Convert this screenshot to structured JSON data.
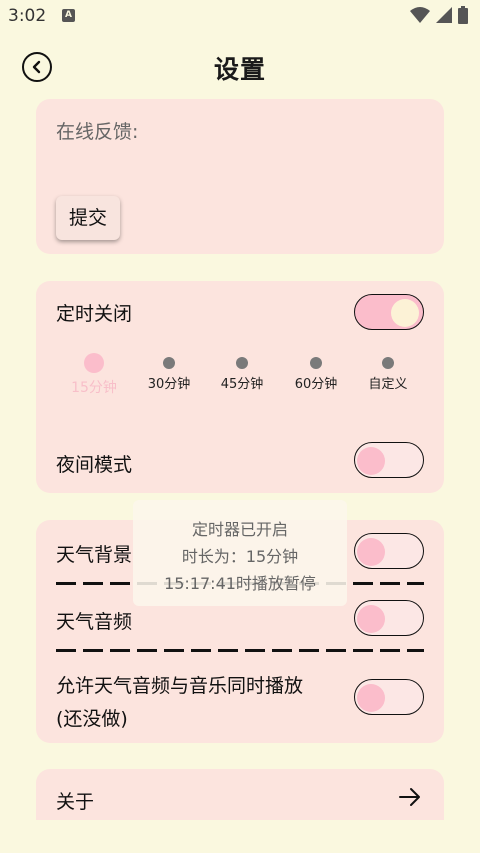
{
  "status_bar": {
    "time": "3:02",
    "notif_letter": "A"
  },
  "header": {
    "title": "设置"
  },
  "feedback": {
    "label": "在线反馈:",
    "submit_label": "提交"
  },
  "timer": {
    "label": "定时关闭",
    "enabled": true,
    "options": [
      "15分钟",
      "30分钟",
      "45分钟",
      "60分钟",
      "自定义"
    ],
    "selected_index": 0,
    "night_mode_label": "夜间模式",
    "night_mode_enabled": false
  },
  "weather": {
    "background_label": "天气背景",
    "background_enabled": false,
    "audio_label": "天气音频",
    "audio_enabled": false,
    "simultaneous_label_line1": "允许天气音频与音乐同时播放",
    "simultaneous_label_line2": "(还没做)",
    "simultaneous_enabled": false
  },
  "toast": {
    "line1": "定时器已开启",
    "line2": "时长为：15分钟",
    "line3": "15:17:41时播放暂停"
  },
  "about": {
    "label": "关于"
  },
  "colors": {
    "background": "#FAF8DF",
    "card": "#FCE4DE",
    "accent_pink": "#FBBDCB",
    "knob_on": "#FCF2D6"
  }
}
